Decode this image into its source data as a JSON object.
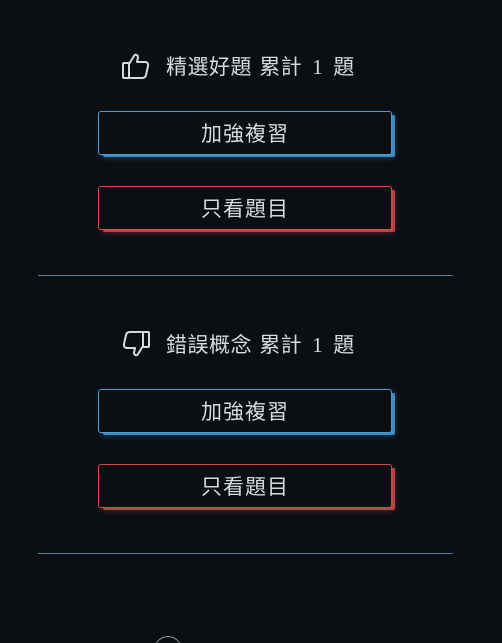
{
  "good_section": {
    "icon": "thumbs-up-icon",
    "label": "精選好題",
    "total_label": "累計",
    "count": "1",
    "unit": "題",
    "review_button": "加強複習",
    "view_button": "只看題目"
  },
  "bad_section": {
    "icon": "thumbs-down-icon",
    "label": "錯誤概念",
    "total_label": "累計",
    "count": "1",
    "unit": "題",
    "review_button": "加強複習",
    "view_button": "只看題目"
  },
  "colors": {
    "background": "#0b0f14",
    "text": "#d7dbe0",
    "accent_blue": "#4a9bd6",
    "accent_red": "#d34a4a",
    "divider": "#4a7fa8"
  }
}
